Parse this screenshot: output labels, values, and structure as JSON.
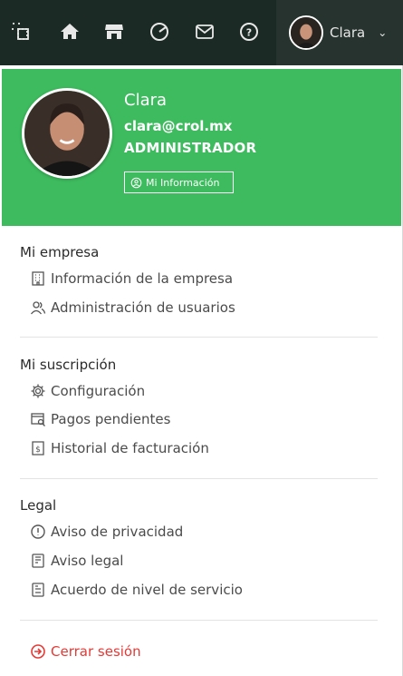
{
  "nav": {
    "icons": [
      "dashboard-icon",
      "home-icon",
      "store-icon",
      "chart-icon",
      "mail-icon",
      "help-icon"
    ]
  },
  "user_chip": {
    "name": "Clara",
    "caret": "⌄"
  },
  "profile": {
    "name": "Clara",
    "email": "clara@crol.mx",
    "role": "ADMINISTRADOR",
    "info_button": "Mi Información"
  },
  "sections": {
    "empresa": {
      "title": "Mi empresa",
      "items": [
        "Información de la empresa",
        "Administración de usuarios"
      ]
    },
    "suscripcion": {
      "title": "Mi suscripción",
      "items": [
        "Configuración",
        "Pagos pendientes",
        "Historial de facturación"
      ]
    },
    "legal": {
      "title": "Legal",
      "items": [
        "Aviso de privacidad",
        "Aviso legal",
        "Acuerdo de nivel de servicio"
      ]
    }
  },
  "logout": "Cerrar sesión",
  "colors": {
    "topbar": "#1c2a26",
    "accent": "#3dbb5e",
    "danger": "#e53935"
  }
}
